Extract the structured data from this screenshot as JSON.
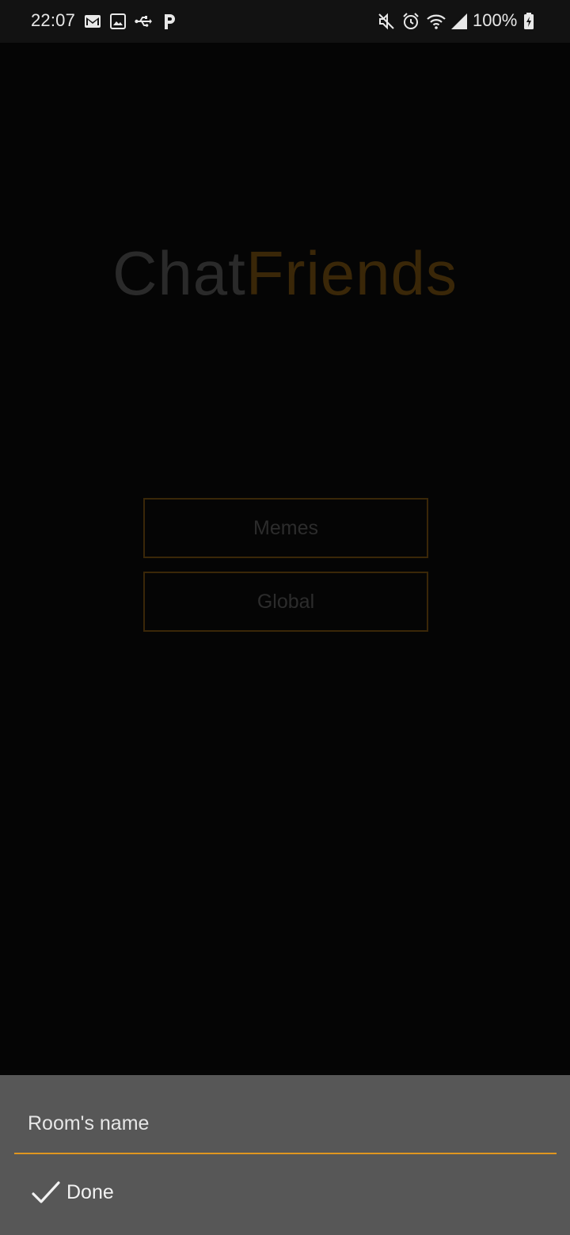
{
  "status_bar": {
    "time": "22:07",
    "battery": "100%",
    "left_icons": [
      "gmail-icon",
      "gallery-icon",
      "usb-icon",
      "parking-icon"
    ],
    "right_icons": [
      "mute-icon",
      "alarm-icon",
      "wifi-icon",
      "signal-icon",
      "battery-charging-icon"
    ]
  },
  "app": {
    "title_part_1": "Chat",
    "title_part_2": "Friends",
    "colors": {
      "background": "#050505",
      "accent": "#e0961f",
      "title_dim": "#2a2a2a",
      "title_accent_dim": "#3a2708"
    }
  },
  "rooms": {
    "items": [
      {
        "label": "Memes"
      },
      {
        "label": "Global"
      }
    ]
  },
  "sheet": {
    "input_placeholder": "Room's name",
    "input_value": "",
    "done_label": "Done",
    "done_icon": "check-icon"
  }
}
